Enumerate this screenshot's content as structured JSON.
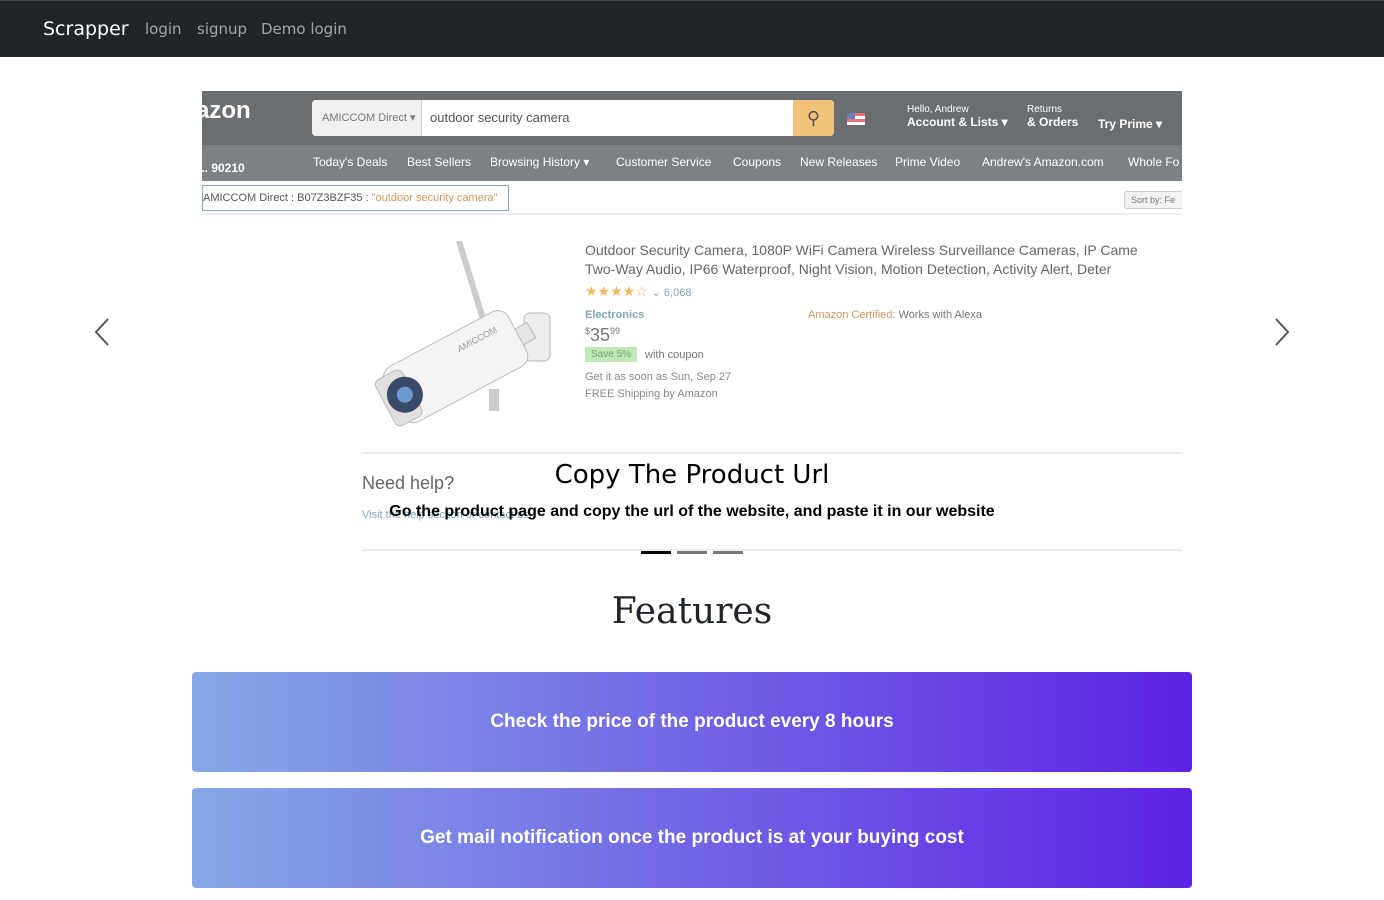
{
  "navbar": {
    "brand": "Scrapper",
    "links": [
      "login",
      "signup",
      "Demo login"
    ]
  },
  "slide": {
    "amazon": {
      "logo": "azon",
      "dept": "AMICCOM Direct ▾",
      "search_query": "outdoor security camera",
      "greeting": "Hello, Andrew",
      "account": "Account & Lists ▾",
      "returns": "Returns",
      "orders": "& Orders",
      "prime": "Try Prime ▾",
      "zip": "... 90210",
      "nav_items": [
        "Today's Deals",
        "Best Sellers",
        "Browsing History ▾",
        "Customer Service",
        "Coupons",
        "New Releases",
        "Prime Video",
        "Andrew's Amazon.com",
        "Whole Fo"
      ],
      "breadcrumb_prefix": "AMICCOM Direct : B07Z3BZF35 : ",
      "breadcrumb_query": "\"outdoor security camera\"",
      "sort": "Sort by: Fe",
      "product_title_1": "Outdoor Security Camera, 1080P WiFi Camera Wireless Surveillance Cameras, IP Came",
      "product_title_2": "Two-Way Audio, IP66 Waterproof, Night Vision, Motion Detection, Activity Alert, Deter",
      "rating_stars": "★★★★☆",
      "rating_count": "⌄ 6,068",
      "category": "Electronics",
      "certified_label": "Amazon Certified:",
      "certified_value": "Works with Alexa",
      "price_symbol": "$",
      "price_whole": "35",
      "price_fraction": "99",
      "save_badge": "Save 5%",
      "coupon_text": "with coupon",
      "delivery": "Get it as soon as Sun, Sep 27",
      "shipping": "FREE Shipping by Amazon",
      "need_help": "Need help?",
      "visit_link": "Visit the help section or contact us"
    },
    "caption_title": "Copy The Product Url",
    "caption_text": "Go the product page and copy the url of the website, and paste it in our website"
  },
  "carousel": {
    "active_index": 0,
    "slide_count": 3
  },
  "features": {
    "heading": "Features",
    "items": [
      "Check the price of the product every 8 hours",
      "Get mail notification once the product is at your buying cost"
    ]
  }
}
